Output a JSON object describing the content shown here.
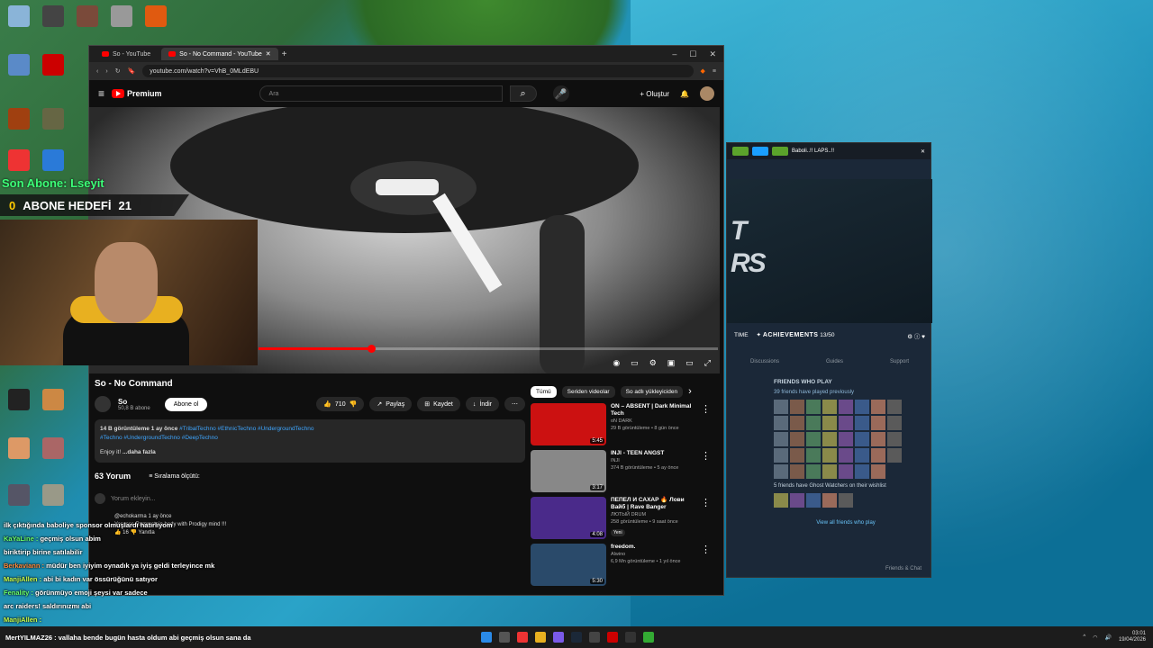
{
  "browser": {
    "tabs": [
      {
        "label": "So - YouTube"
      },
      {
        "label": "So - No Command - YouTube"
      }
    ],
    "url": "youtube.com/watch?v=VhB_0MLdEBU"
  },
  "youtube": {
    "logo": "Premium",
    "search_placeholder": "Ara",
    "create_label": "Oluştur",
    "video_title": "So - No Command",
    "channel": {
      "name": "So",
      "subs": "50,8 B abone",
      "subscribe_label": "Abone ol"
    },
    "actions": {
      "likes": "710",
      "share": "Paylaş",
      "save": "Kaydet",
      "download": "İndir"
    },
    "description": {
      "meta": "14 B görüntüleme  1 ay önce",
      "tags1": "#TribalTechno #EthnicTechno #UndergroundTechno",
      "tags2": "#Techno #UndergroundTechno #DeepTechno",
      "text": "Enjoy it!",
      "more": "...daha fazla"
    },
    "comments": {
      "count": "63 Yorum",
      "sort": "Sıralama ölçütü:",
      "add_placeholder": "Yorum ekleyin...",
      "first": {
        "author": "@echokarma",
        "time": "1 ay önce",
        "text": "Yesssss Rammstein body with Prodigy mind !!!",
        "likes": "16",
        "reply": "Yanıtla"
      }
    },
    "chips": [
      "Tümü",
      "Seriden videolar",
      "So adlı yükleyiciden"
    ],
    "recommendations": [
      {
        "title": "ON – ABSENT | Dark Minimal Tech",
        "channel": "oN DARK",
        "meta": "29 B görüntüleme • 8 gün önce",
        "duration": "5:45",
        "color": "#c11"
      },
      {
        "title": "INJI - TEEN ANGST",
        "channel": "INJI",
        "meta": "374 B görüntüleme • 5 ay önce",
        "duration": "3:17",
        "color": "#888"
      },
      {
        "title": "ПЕПЕЛ И САХАР 🔥 Лови Вайб | Rave Banger",
        "channel": "ЛЮТЫЙ DRUM",
        "meta": "258 görüntüleme • 9 saat önce",
        "duration": "4:08",
        "color": "#4a2a8a",
        "badge": "Yeni"
      },
      {
        "title": "freedom.",
        "channel": "Alwino",
        "meta": "6,9 Mn görüntüleme • 1 yıl önce",
        "duration": "5:30",
        "color": "#2a4a6a"
      }
    ]
  },
  "steam": {
    "user": "Baboli..!! LAPS..!!",
    "hero_text": "T\nRS",
    "achievements_label": "ACHIEVEMENTS",
    "achievements_value": "13/50",
    "time_label": "TIME",
    "tabs": [
      "Discussions",
      "Guides",
      "Support"
    ],
    "friends_title": "FRIENDS WHO PLAY",
    "played_text": "39 friends have played previously",
    "wishlist_text": "5 friends have Ghost Watchers on their wishlist",
    "view_all": "View all friends who play",
    "friends_chat": "Friends & Chat"
  },
  "stream": {
    "last_sub": "Son Abone: Lseyit",
    "goal_count": "0",
    "goal_label": "ABONE HEDEFİ",
    "goal_target": "21"
  },
  "chat": [
    {
      "name": "",
      "text": "ilk çıktığında baboliye sponsor olmuşlardı hatırlıyom",
      "cls": "n1"
    },
    {
      "name": "KaYaLine :",
      "text": "geçmiş olsun abim",
      "cls": "n2"
    },
    {
      "name": "",
      "text": "biriktirip birine satılabilir",
      "cls": "n1"
    },
    {
      "name": "Berkaviann :",
      "text": "müdür ben iyiyim oynadık ya iyiş geldi terleyince mk",
      "cls": "n1"
    },
    {
      "name": "ManjiAllen :",
      "text": "abi bi kadın var össürüğünü satıyor",
      "cls": "n3"
    },
    {
      "name": "Fenality :",
      "text": "görünmüyo emoji şeysi var sadece",
      "cls": "n2"
    },
    {
      "name": "",
      "text": "arc raiders! saldırınızmı abi",
      "cls": "n1"
    },
    {
      "name": "ManjiAllen :",
      "text": "",
      "cls": "n3"
    }
  ],
  "taskbar": {
    "message": "MertYILMAZ26 : vallaha bende bugün hasta oldum abi geçmiş olsun sana da",
    "time": "03:01",
    "date": "19/04/2026"
  }
}
